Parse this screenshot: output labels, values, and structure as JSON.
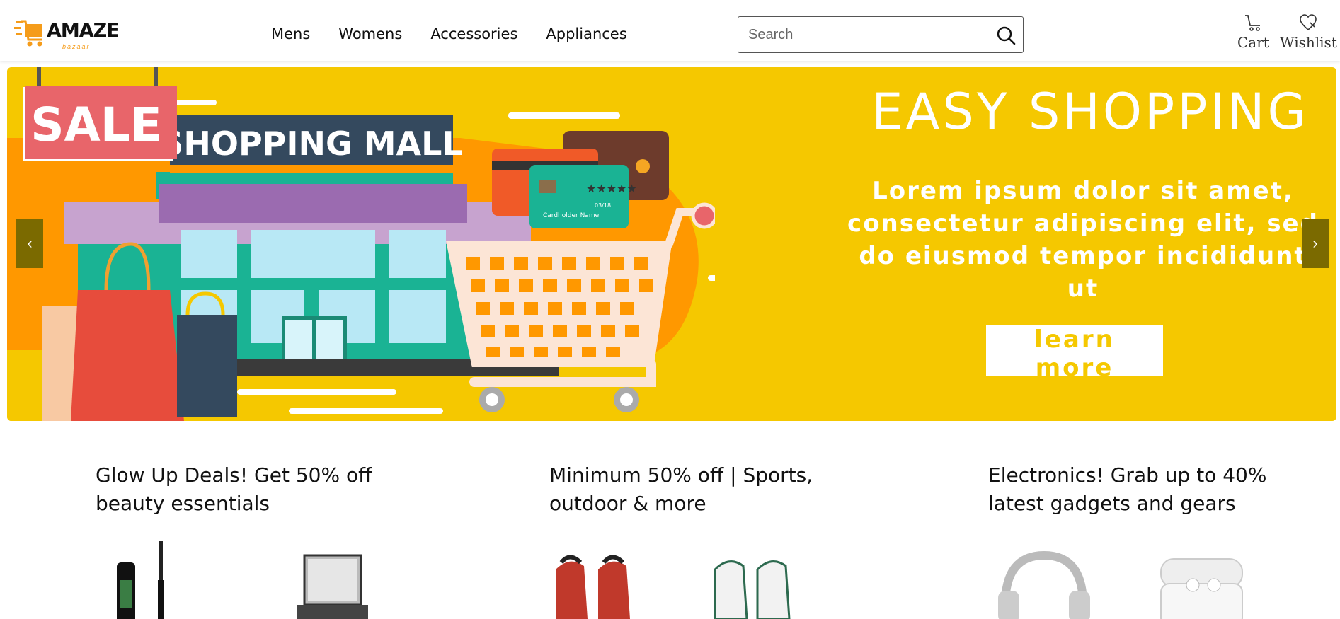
{
  "brand": {
    "name": "AMAZE",
    "tagline": "bazaar",
    "accent": "#f59c1a"
  },
  "nav": {
    "items": [
      "Mens",
      "Womens",
      "Accessories",
      "Appliances"
    ]
  },
  "search": {
    "placeholder": "Search",
    "icon": "search-icon"
  },
  "header_actions": {
    "cart_label": "Cart",
    "wishlist_label": "Wishlist"
  },
  "banner": {
    "background": "#f5c800",
    "sale_sign": "SALE",
    "mall_sign": "SHOPPING MALL",
    "card_label": "Cardholder Name",
    "card_expiry": "03/18",
    "headline": "EASY SHOPPING",
    "body": "Lorem ipsum dolor sit amet, consectetur adipiscing elit, sed do eiusmod tempor incididunt ut",
    "cta_label": "learn more",
    "prev_label": "‹",
    "next_label": "›"
  },
  "deals": [
    {
      "title": "Glow Up Deals! Get 50% off beauty essentials"
    },
    {
      "title": "Minimum 50% off | Sports, outdoor & more"
    },
    {
      "title": "Electronics! Grab up to 40% latest gadgets and gears"
    }
  ]
}
